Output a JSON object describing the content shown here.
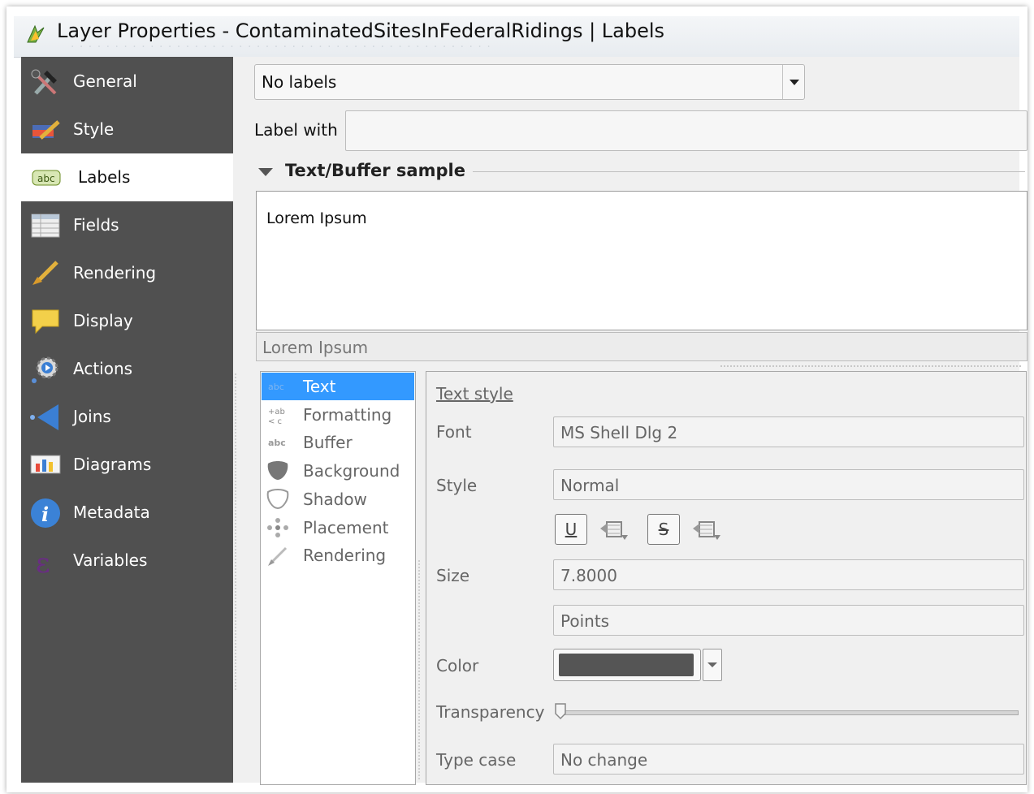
{
  "window": {
    "title": "Layer Properties - ContaminatedSitesInFederalRidings | Labels"
  },
  "sidebar": {
    "items": [
      {
        "label": "General"
      },
      {
        "label": "Style"
      },
      {
        "label": "Labels"
      },
      {
        "label": "Fields"
      },
      {
        "label": "Rendering"
      },
      {
        "label": "Display"
      },
      {
        "label": "Actions"
      },
      {
        "label": "Joins"
      },
      {
        "label": "Diagrams"
      },
      {
        "label": "Metadata"
      },
      {
        "label": "Variables"
      }
    ]
  },
  "labels": {
    "mode_value": "No labels",
    "label_with_label": "Label with",
    "label_with_value": "",
    "section_title": "Text/Buffer sample",
    "sample_text": "Lorem Ipsum",
    "sample_input_value": "Lorem Ipsum"
  },
  "subnav": {
    "items": [
      {
        "label": "Text",
        "icon_text": "abc"
      },
      {
        "label": "Formatting",
        "icon_text": "+ab"
      },
      {
        "label": "Buffer",
        "icon_text": "abc"
      },
      {
        "label": "Background"
      },
      {
        "label": "Shadow"
      },
      {
        "label": "Placement"
      },
      {
        "label": "Rendering"
      }
    ]
  },
  "text_style": {
    "heading": "Text style",
    "font_label": "Font",
    "font_value": "MS Shell Dlg 2",
    "style_label": "Style",
    "style_value": "Normal",
    "underline_glyph": "U",
    "strike_glyph": "S",
    "size_label": "Size",
    "size_value": "7.8000",
    "unit_value": "Points",
    "color_label": "Color",
    "color_value": "#555555",
    "transparency_label": "Transparency",
    "transparency": 0,
    "type_case_label": "Type case",
    "type_case_value": "No change"
  },
  "colors": {
    "sidebar_bg": "#505050",
    "selection": "#3399ff"
  }
}
